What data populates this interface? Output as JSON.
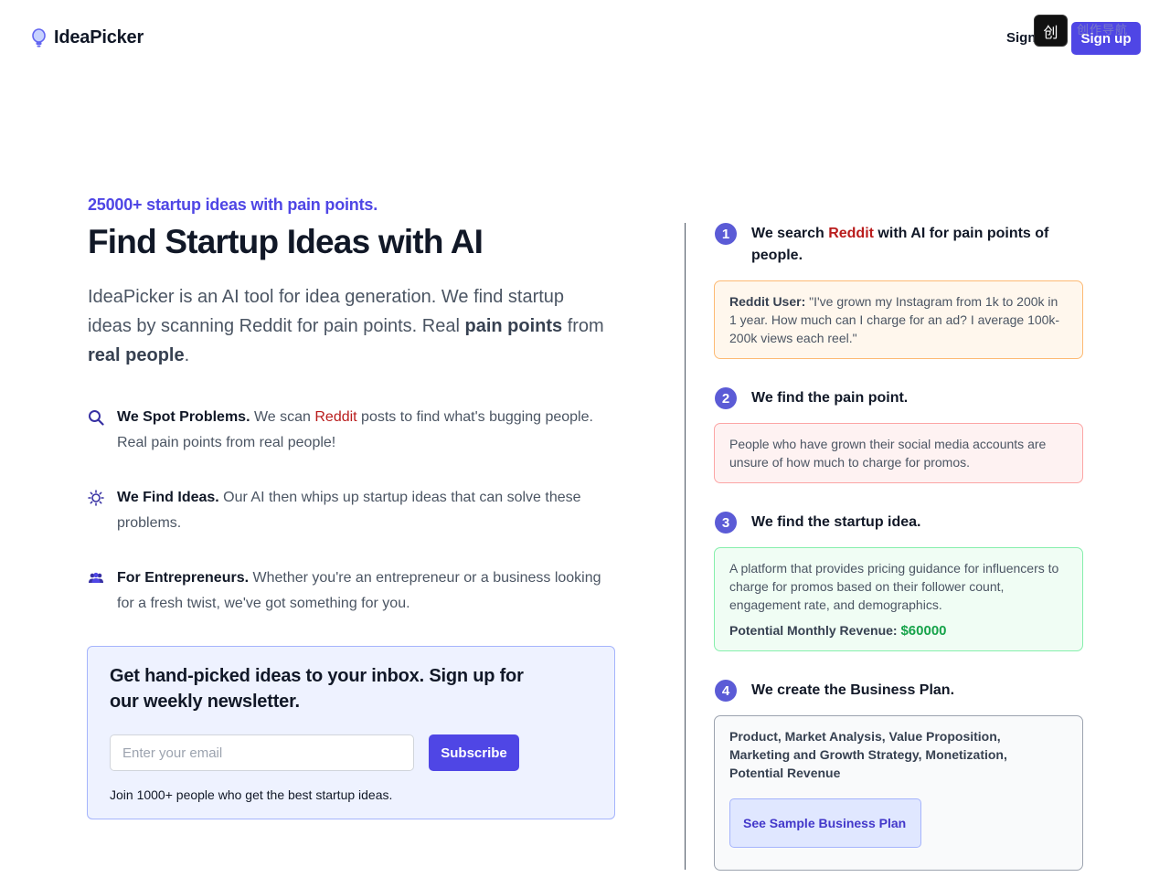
{
  "header": {
    "logo_text": "IdeaPicker",
    "signin_label": "Sign",
    "signup_label": "Sign up",
    "watermark": "创作导航"
  },
  "hero": {
    "eyebrow": "25000+ startup ideas with pain points.",
    "title": "Find Startup Ideas with AI",
    "desc_part1": "IdeaPicker is an AI tool for idea generation. We find startup ideas by scanning Reddit for pain points. Real ",
    "desc_bold1": "pain points",
    "desc_part2": " from ",
    "desc_bold2": "real people",
    "desc_part3": "."
  },
  "features": [
    {
      "title": "We Spot Problems.",
      "text_before": " We scan ",
      "highlight": "Reddit",
      "text_after": " posts to find what's bugging people. Real pain points from real people!",
      "icon": "search-icon"
    },
    {
      "title": "We Find Ideas.",
      "text": " Our AI then whips up startup ideas that can solve these problems.",
      "icon": "lightbulb-icon"
    },
    {
      "title": "For Entrepreneurs.",
      "text": " Whether you're an entrepreneur or a business looking for a fresh twist, we've got something for you.",
      "icon": "users-icon"
    }
  ],
  "newsletter": {
    "title": "Get hand-picked ideas to your inbox. Sign up for our weekly newsletter.",
    "email_placeholder": "Enter your email",
    "subscribe_label": "Subscribe",
    "note": "Join 1000+ people who get the best startup ideas."
  },
  "steps": [
    {
      "num": "1",
      "title_before": "We search ",
      "title_highlight": "Reddit",
      "title_after": " with AI for pain points of people.",
      "card_label": "Reddit User:",
      "card_text": " \"I've grown my Instagram from 1k to 200k in 1 year. How much can I charge for an ad? I average 100k-200k views each reel.\""
    },
    {
      "num": "2",
      "title": "We find the pain point.",
      "card_text": "People who have grown their social media accounts are unsure of how much to charge for promos."
    },
    {
      "num": "3",
      "title": "We find the startup idea.",
      "card_text": "A platform that provides pricing guidance for influencers to charge for promos based on their follower count, engagement rate, and demographics.",
      "revenue_label": "Potential Monthly Revenue:",
      "revenue_value": "$60000"
    },
    {
      "num": "4",
      "title": "We create the Business Plan.",
      "card_text": "Product, Market Analysis, Value Proposition, Marketing and Growth Strategy, Monetization, Potential Revenue",
      "button_label": "See Sample Business Plan"
    }
  ],
  "colors": {
    "brand": "#4f46e5",
    "reddit": "#b91c1c",
    "revenue": "#16a34a",
    "step_badge": "#5b5bd6"
  }
}
